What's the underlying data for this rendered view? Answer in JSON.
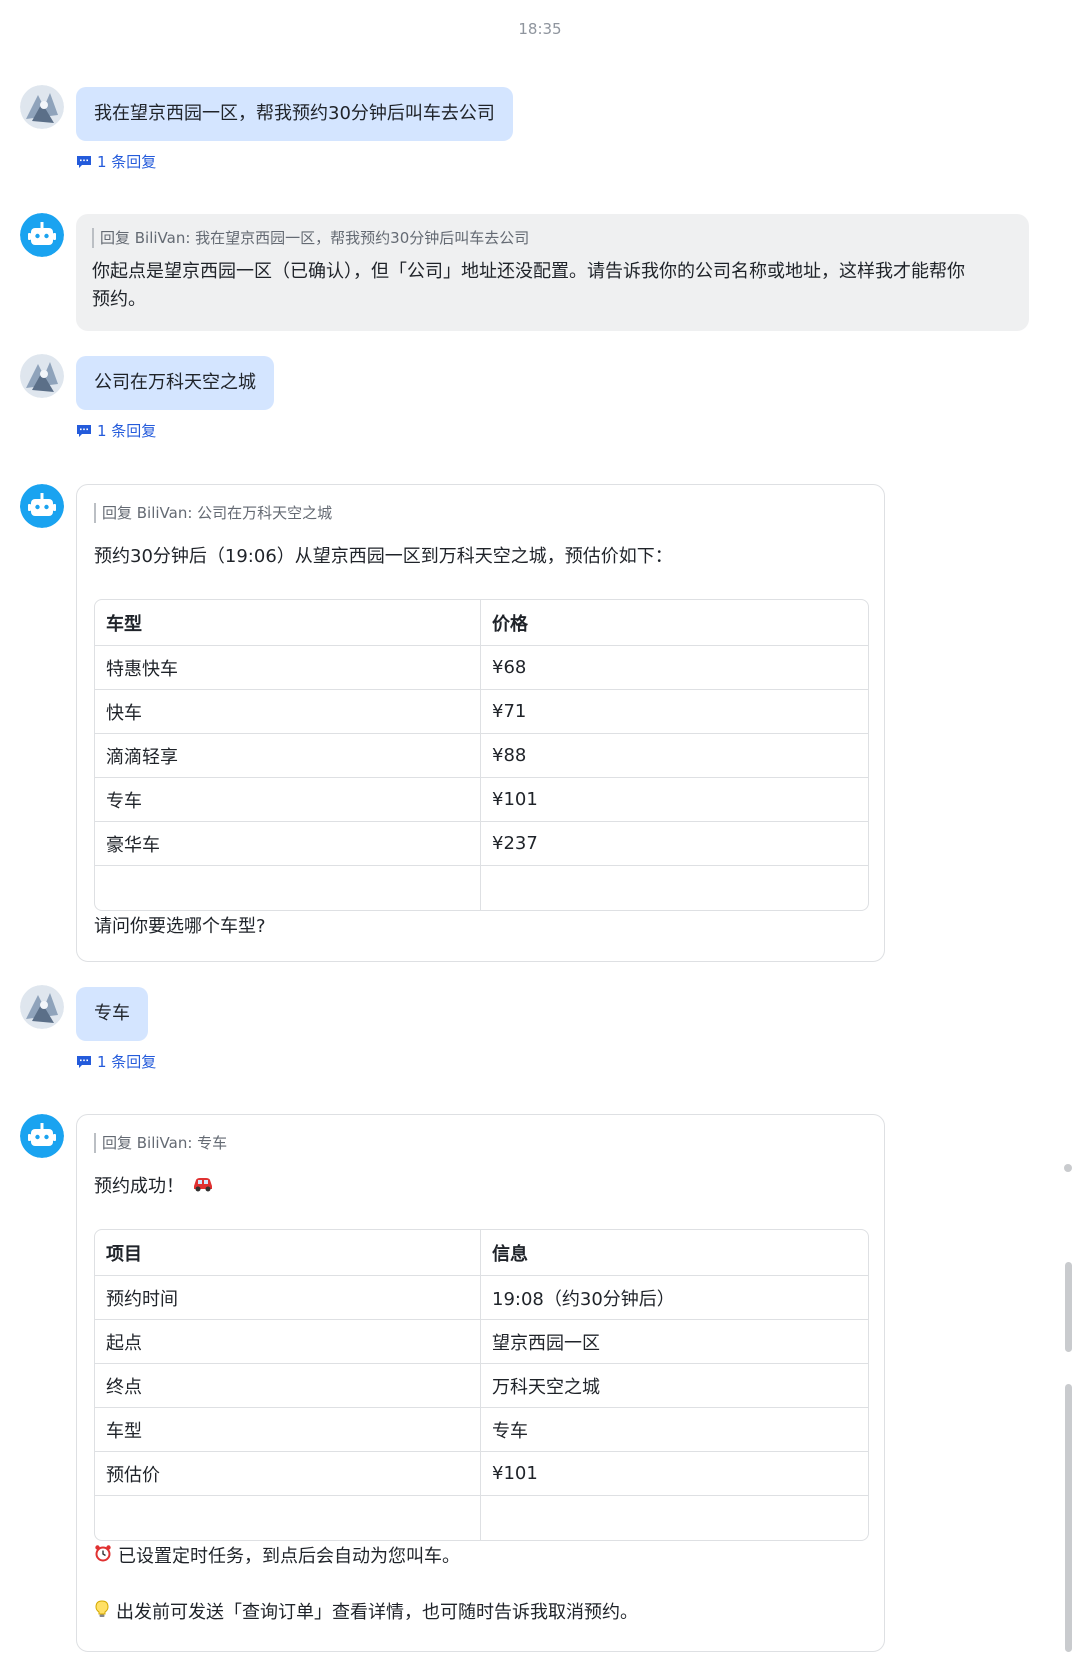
{
  "timestamp": "18:35",
  "messages": [
    {
      "user_text": "我在望京西园一区，帮我预约30分钟后叫车去公司",
      "reply_count": "1 条回复"
    },
    {
      "quote": "回复 BiliVan: 我在望京西园一区，帮我预约30分钟后叫车去公司",
      "bot_line1": "你起点是望京西园一区（已确认），但「公司」地址还没配置。请告诉我你的公司名称或地址，这样我才能帮你",
      "bot_line2": "预约。"
    },
    {
      "user_text": "公司在万科天空之城",
      "reply_count": "1 条回复"
    },
    {
      "quote": "回复 BiliVan: 公司在万科天空之城",
      "bot_text": "预约30分钟后（19:06）从望京西园一区到万科天空之城，预估价如下：",
      "table_headers": [
        "车型",
        "价格"
      ],
      "table_rows": [
        [
          "特惠快车",
          "¥68"
        ],
        [
          "快车",
          "¥71"
        ],
        [
          "滴滴轻享",
          "¥88"
        ],
        [
          "专车",
          "¥101"
        ],
        [
          "豪华车",
          "¥237"
        ],
        [
          "",
          ""
        ]
      ],
      "after_table": "请问你要选哪个车型?"
    },
    {
      "user_text": "专车",
      "reply_count": "1 条回复"
    },
    {
      "quote": "回复 BiliVan: 专车",
      "bot_text": "预约成功！",
      "table_headers": [
        "项目",
        "信息"
      ],
      "table_rows": [
        [
          "预约时间",
          "19:08（约30分钟后）"
        ],
        [
          "起点",
          "望京西园一区"
        ],
        [
          "终点",
          "万科天空之城"
        ],
        [
          "车型",
          "专车"
        ],
        [
          "预估价",
          "¥101"
        ],
        [
          "",
          ""
        ]
      ],
      "note1": "已设置定时任务，到点后会自动为您叫车。",
      "note2": "出发前可发送「查询订单」查看详情，也可随时告诉我取消预约。"
    }
  ],
  "icons": {
    "user_avatar": "user-avatar-icon",
    "bot_avatar": "robot-icon",
    "reply": "comment-icon",
    "car": "car-icon",
    "alarm": "alarm-clock-icon",
    "bulb": "light-bulb-icon"
  },
  "colors": {
    "user_bubble": "#d4e5ff",
    "bot_bubble": "#eff0f1",
    "accent": "#245bdb",
    "bot_avatar": "#1aa3f0"
  }
}
